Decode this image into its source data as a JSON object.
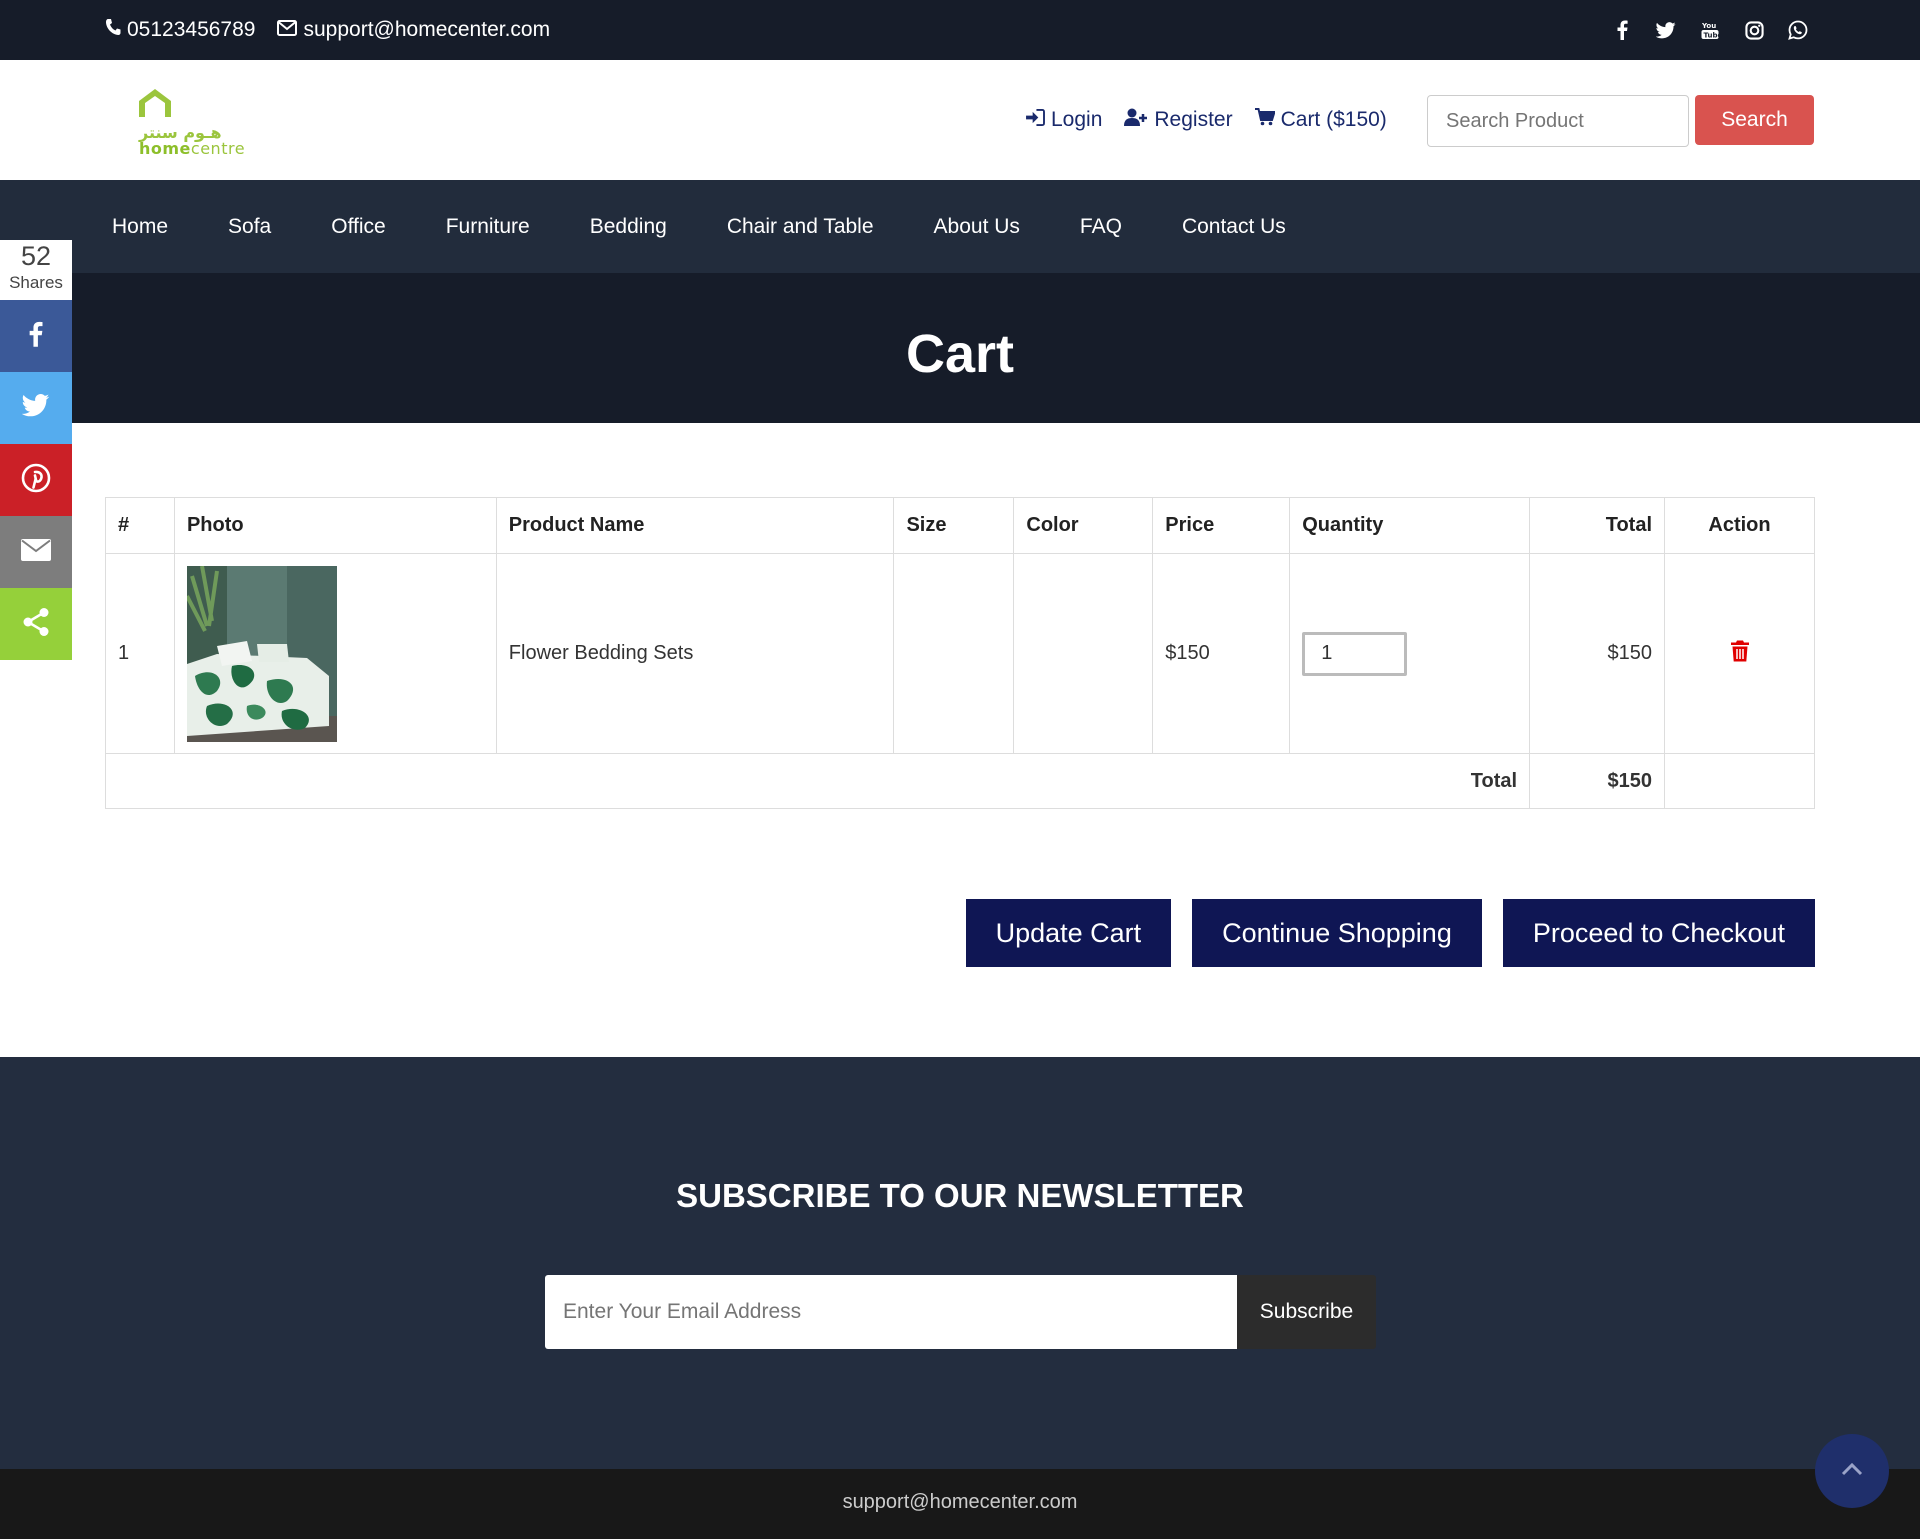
{
  "topbar": {
    "phone": "05123456789",
    "email": "support@homecenter.com"
  },
  "header": {
    "logo_arabic": "هـوم سنتر",
    "logo_latin_home": "home",
    "logo_latin_centre": "centre",
    "login_label": "Login",
    "register_label": "Register",
    "cart_label": "Cart ($150)",
    "search_placeholder": "Search Product",
    "search_button": "Search"
  },
  "nav": {
    "items": [
      "Home",
      "Sofa",
      "Office",
      "Furniture",
      "Bedding",
      "Chair and Table",
      "About Us",
      "FAQ",
      "Contact Us"
    ]
  },
  "share": {
    "count": "52",
    "label": "Shares",
    "colors": {
      "facebook": "#3b5998",
      "twitter": "#55acee",
      "pinterest": "#cb2027",
      "email": "#7d7d7d",
      "share": "#95d03a"
    }
  },
  "page": {
    "title": "Cart"
  },
  "table": {
    "headers": [
      "#",
      "Photo",
      "Product Name",
      "Size",
      "Color",
      "Price",
      "Quantity",
      "Total",
      "Action"
    ],
    "rows": [
      {
        "index": "1",
        "name": "Flower Bedding Sets",
        "size": "",
        "color": "",
        "price": "$150",
        "quantity": "1",
        "total": "$150"
      }
    ],
    "footer_label": "Total",
    "footer_total": "$150"
  },
  "actions": {
    "update": "Update Cart",
    "continue": "Continue Shopping",
    "checkout": "Proceed to Checkout"
  },
  "newsletter": {
    "title": "SUBSCRIBE TO OUR NEWSLETTER",
    "placeholder": "Enter Your Email Address",
    "button": "Subscribe"
  },
  "footer": {
    "email": "support@homecenter.com"
  }
}
